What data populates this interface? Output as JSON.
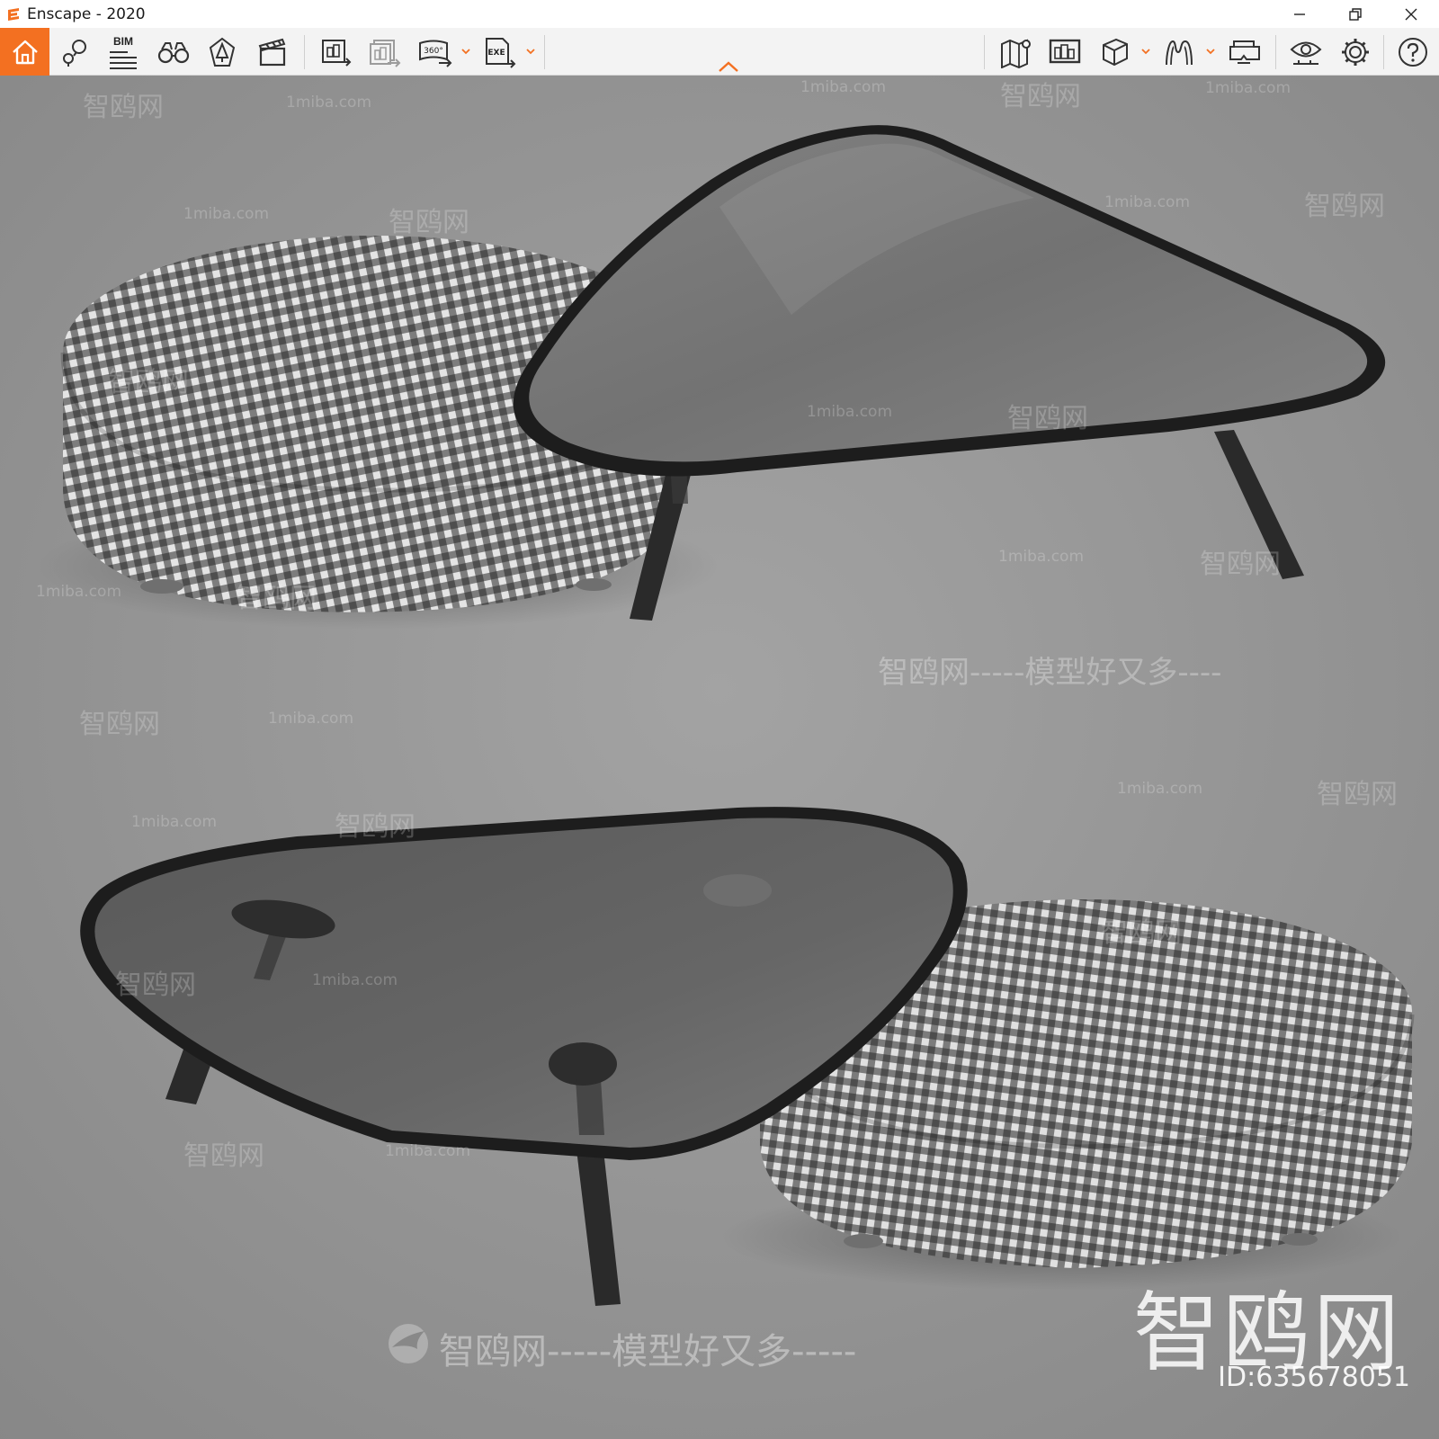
{
  "window": {
    "title": "Enscape - 2020",
    "accent_color": "#f37021"
  },
  "toolbar": {
    "bim_label": "BIM",
    "panorama_label": "360°",
    "exe_label": "EXE",
    "items": [
      {
        "name": "home",
        "icon": "home-icon"
      },
      {
        "name": "view-management",
        "icon": "pin-icon"
      },
      {
        "name": "bim-info",
        "icon": "bim-icon"
      },
      {
        "name": "walk-mode",
        "icon": "binoculars-icon"
      },
      {
        "name": "asset-library",
        "icon": "tree-icon"
      },
      {
        "name": "video-editor",
        "icon": "clapperboard-icon"
      },
      {
        "name": "render-image",
        "icon": "render-image-icon"
      },
      {
        "name": "batch-render",
        "icon": "batch-render-icon"
      },
      {
        "name": "render-panorama",
        "icon": "panorama-icon"
      },
      {
        "name": "export-exe",
        "icon": "exe-icon"
      },
      {
        "name": "map",
        "icon": "map-icon"
      },
      {
        "name": "screenshot-view",
        "icon": "monitor-icon"
      },
      {
        "name": "materials",
        "icon": "cube-icon"
      },
      {
        "name": "orthographic",
        "icon": "sculpture-icon"
      },
      {
        "name": "vr-headset",
        "icon": "vr-headset-icon"
      },
      {
        "name": "visual-settings",
        "icon": "eye-icon"
      },
      {
        "name": "general-settings",
        "icon": "gear-icon"
      },
      {
        "name": "help",
        "icon": "help-icon"
      }
    ]
  },
  "viewport": {
    "watermarks": {
      "site": "1miba.com",
      "brand_cn": "智鸥网",
      "slogan": "智鸥网-----模型好又多----",
      "slogan_short": "智鸥网-----模型好又多-----"
    },
    "brand_mark": "智鸥网",
    "id_label": "ID:635678051"
  }
}
